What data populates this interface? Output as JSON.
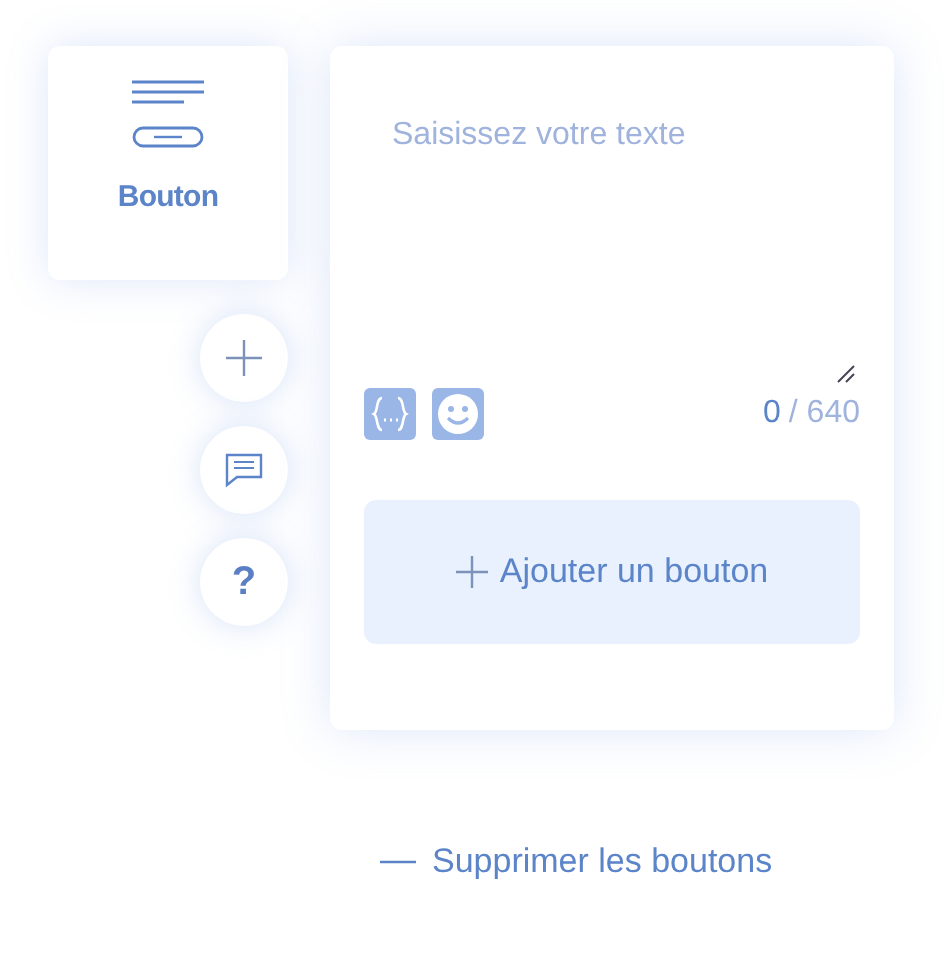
{
  "palette_card": {
    "label": "Bouton"
  },
  "side_buttons": [
    {
      "kind": "add"
    },
    {
      "kind": "comment"
    },
    {
      "kind": "help",
      "label": "?"
    }
  ],
  "editor": {
    "placeholder": "Saisissez votre texte",
    "count": "0",
    "limit": "/ 640",
    "add_button": "Ajouter un bouton"
  },
  "remove_link": "Supprimer les boutons"
}
